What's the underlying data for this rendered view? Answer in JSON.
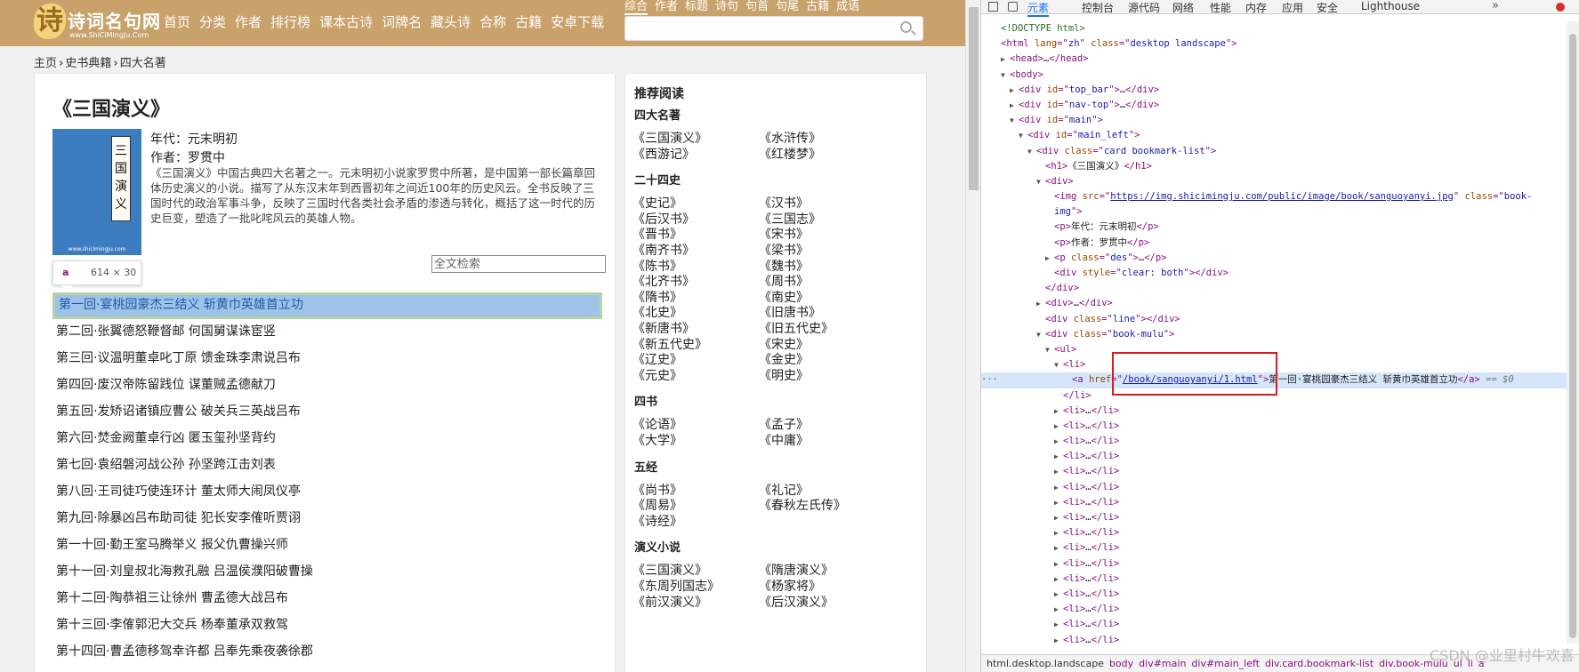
{
  "site": {
    "logo_text": "诗词名句网",
    "logo_url": "www.ShiCiMingJu.Com",
    "nav": [
      "首页",
      "分类",
      "作者",
      "排行榜",
      "课本古诗",
      "词牌名",
      "藏头诗",
      "合称",
      "古籍",
      "安卓下载"
    ],
    "search_tabs": [
      "综合",
      "作者",
      "标题",
      "诗句",
      "句首",
      "句尾",
      "古籍",
      "成语"
    ],
    "breadcrumb": [
      "主页",
      "史书典籍",
      "四大名著"
    ],
    "book": {
      "title": "《三国演义》",
      "cover_text": "三国演义",
      "cover_site": "www.shicimingju.com",
      "era": "年代：元末明初",
      "author": "作者：罗贯中",
      "description": "《三国演义》中国古典四大名著之一。元末明初小说家罗贯中所著，是中国第一部长篇章回体历史演义的小说。描写了从东汉末年到西晋初年之间近100年的历史风云。全书反映了三国时代的政治军事斗争，反映了三国时代各类社会矛盾的渗透与转化，概括了这一时代的历史巨变，塑造了一批叱咤风云的英雄人物。",
      "search_placeholder": "全文检索"
    },
    "tooltip": {
      "tag": "a",
      "size": "614 × 30"
    },
    "chapters": [
      "第一回·宴桃园豪杰三结义 斩黄巾英雄首立功",
      "第二回·张翼德怒鞭督邮 何国舅谋诛宦竖",
      "第三回·议温明董卓叱丁原 馈金珠李肃说吕布",
      "第四回·废汉帝陈留践位 谋董贼孟德献刀",
      "第五回·发矫诏诸镇应曹公 破关兵三英战吕布",
      "第六回·焚金阙董卓行凶 匿玉玺孙坚背约",
      "第七回·袁绍磐河战公孙 孙坚跨江击刘表",
      "第八回·王司徒巧使连环计 董太师大闹凤仪亭",
      "第九回·除暴凶吕布助司徒 犯长安李傕听贾诩",
      "第一十回·勤王室马腾举义 报父仇曹操兴师",
      "第十一回·刘皇叔北海救孔融 吕温侯濮阳破曹操",
      "第十二回·陶恭祖三让徐州 曹孟德大战吕布",
      "第十三回·李傕郭汜大交兵 杨奉董承双救驾",
      "第十四回·曹孟德移驾幸许都 吕奉先乘夜袭徐郡"
    ],
    "sidebar": {
      "title": "推荐阅读",
      "categories": [
        {
          "name": "四大名著",
          "books": [
            "《三国演义》",
            "《水浒传》",
            "《西游记》",
            "《红楼梦》"
          ]
        },
        {
          "name": "二十四史",
          "books": [
            "《史记》",
            "《汉书》",
            "《后汉书》",
            "《三国志》",
            "《晋书》",
            "《宋书》",
            "《南齐书》",
            "《梁书》",
            "《陈书》",
            "《魏书》",
            "《北齐书》",
            "《周书》",
            "《隋书》",
            "《南史》",
            "《北史》",
            "《旧唐书》",
            "《新唐书》",
            "《旧五代史》",
            "《新五代史》",
            "《宋史》",
            "《辽史》",
            "《金史》",
            "《元史》",
            "《明史》"
          ]
        },
        {
          "name": "四书",
          "books": [
            "《论语》",
            "《孟子》",
            "《大学》",
            "《中庸》"
          ]
        },
        {
          "name": "五经",
          "books": [
            "《尚书》",
            "《礼记》",
            "《周易》",
            "《春秋左氏传》",
            "《诗经》"
          ]
        },
        {
          "name": "演义小说",
          "books": [
            "《三国演义》",
            "《隋唐演义》",
            "《东周列国志》",
            "《杨家将》",
            "《前汉演义》",
            "《后汉演义》"
          ]
        }
      ]
    }
  },
  "devtools": {
    "tabs": [
      "元素",
      "控制台",
      "源代码",
      "网络",
      "性能",
      "内存",
      "应用",
      "安全",
      "Lighthouse"
    ],
    "tree": [
      {
        "i": 0,
        "t": "",
        "seg": [
          [
            "cm",
            "<!DOCTYPE html>"
          ]
        ]
      },
      {
        "i": 0,
        "t": "",
        "seg": [
          [
            "tg",
            "<html "
          ],
          [
            "at",
            "lang"
          ],
          [
            "tg",
            "=\""
          ],
          [
            "av",
            "zh"
          ],
          [
            "tg",
            "\" "
          ],
          [
            "at",
            "class"
          ],
          [
            "tg",
            "=\""
          ],
          [
            "av",
            "desktop landscape"
          ],
          [
            "tg",
            "\">"
          ]
        ]
      },
      {
        "i": 1,
        "t": "▶",
        "seg": [
          [
            "tg",
            "<head>"
          ],
          [
            "tx",
            "…"
          ],
          [
            "tg",
            "</head>"
          ]
        ]
      },
      {
        "i": 1,
        "t": "▼",
        "seg": [
          [
            "tg",
            "<body>"
          ]
        ]
      },
      {
        "i": 2,
        "t": "▶",
        "seg": [
          [
            "tg",
            "<div "
          ],
          [
            "at",
            "id"
          ],
          [
            "tg",
            "=\""
          ],
          [
            "av",
            "top_bar"
          ],
          [
            "tg",
            "\">"
          ],
          [
            "tx",
            "…"
          ],
          [
            "tg",
            "</div>"
          ]
        ]
      },
      {
        "i": 2,
        "t": "▶",
        "seg": [
          [
            "tg",
            "<div "
          ],
          [
            "at",
            "id"
          ],
          [
            "tg",
            "=\""
          ],
          [
            "av",
            "nav-top"
          ],
          [
            "tg",
            "\">"
          ],
          [
            "tx",
            "…"
          ],
          [
            "tg",
            "</div>"
          ]
        ]
      },
      {
        "i": 2,
        "t": "▼",
        "seg": [
          [
            "tg",
            "<div "
          ],
          [
            "at",
            "id"
          ],
          [
            "tg",
            "=\""
          ],
          [
            "av",
            "main"
          ],
          [
            "tg",
            "\">"
          ]
        ]
      },
      {
        "i": 3,
        "t": "▼",
        "seg": [
          [
            "tg",
            "<div "
          ],
          [
            "at",
            "id"
          ],
          [
            "tg",
            "=\""
          ],
          [
            "av",
            "main_left"
          ],
          [
            "tg",
            "\">"
          ]
        ]
      },
      {
        "i": 4,
        "t": "▼",
        "seg": [
          [
            "tg",
            "<div "
          ],
          [
            "at",
            "class"
          ],
          [
            "tg",
            "=\""
          ],
          [
            "av",
            "card bookmark-list"
          ],
          [
            "tg",
            "\">"
          ]
        ]
      },
      {
        "i": 5,
        "t": "",
        "seg": [
          [
            "tg",
            "<h1>"
          ],
          [
            "tx",
            "《三国演义》"
          ],
          [
            "tg",
            "</h1>"
          ]
        ]
      },
      {
        "i": 5,
        "t": "▼",
        "seg": [
          [
            "tg",
            "<div>"
          ]
        ]
      },
      {
        "i": 6,
        "t": "",
        "seg": [
          [
            "tg",
            "<img "
          ],
          [
            "at",
            "src"
          ],
          [
            "tg",
            "=\""
          ],
          [
            "lk",
            "https://img.shicimingju.com/public/image/book/sanguoyanyi.jpg"
          ],
          [
            "tg",
            "\" "
          ],
          [
            "at",
            "class"
          ],
          [
            "tg",
            "=\""
          ],
          [
            "av",
            "book-"
          ]
        ]
      },
      {
        "i": 6,
        "t": "",
        "seg": [
          [
            "av",
            "img"
          ],
          [
            "tg",
            "\">"
          ]
        ]
      },
      {
        "i": 6,
        "t": "",
        "seg": [
          [
            "tg",
            "<p>"
          ],
          [
            "tx",
            "年代：元末明初"
          ],
          [
            "tg",
            "</p>"
          ]
        ]
      },
      {
        "i": 6,
        "t": "",
        "seg": [
          [
            "tg",
            "<p>"
          ],
          [
            "tx",
            "作者：罗贯中"
          ],
          [
            "tg",
            "</p>"
          ]
        ]
      },
      {
        "i": 6,
        "t": "▶",
        "seg": [
          [
            "tg",
            "<p "
          ],
          [
            "at",
            "class"
          ],
          [
            "tg",
            "=\""
          ],
          [
            "av",
            "des"
          ],
          [
            "tg",
            "\">"
          ],
          [
            "tx",
            "…"
          ],
          [
            "tg",
            "</p>"
          ]
        ]
      },
      {
        "i": 6,
        "t": "",
        "seg": [
          [
            "tg",
            "<div "
          ],
          [
            "at",
            "style"
          ],
          [
            "tg",
            "=\""
          ],
          [
            "av",
            "clear: both"
          ],
          [
            "tg",
            "\"></div>"
          ]
        ]
      },
      {
        "i": 5,
        "t": "",
        "seg": [
          [
            "tg",
            "</div>"
          ]
        ]
      },
      {
        "i": 5,
        "t": "▶",
        "seg": [
          [
            "tg",
            "<div>"
          ],
          [
            "tx",
            "…"
          ],
          [
            "tg",
            "</div>"
          ]
        ]
      },
      {
        "i": 5,
        "t": "",
        "seg": [
          [
            "tg",
            "<div "
          ],
          [
            "at",
            "class"
          ],
          [
            "tg",
            "=\""
          ],
          [
            "av",
            "line"
          ],
          [
            "tg",
            "\"></div>"
          ]
        ]
      },
      {
        "i": 5,
        "t": "▼",
        "seg": [
          [
            "tg",
            "<div "
          ],
          [
            "at",
            "class"
          ],
          [
            "tg",
            "=\""
          ],
          [
            "av",
            "book-mulu"
          ],
          [
            "tg",
            "\">"
          ]
        ]
      },
      {
        "i": 6,
        "t": "▼",
        "seg": [
          [
            "tg",
            "<ul>"
          ]
        ]
      },
      {
        "i": 7,
        "t": "▼",
        "seg": [
          [
            "tg",
            "<li>"
          ]
        ]
      },
      {
        "i": 8,
        "t": "",
        "sel": true,
        "seg": [
          [
            "tg",
            "<a "
          ],
          [
            "at",
            "href"
          ],
          [
            "tg",
            "=\""
          ],
          [
            "lk",
            "/book/sanguoyanyi/1.html"
          ],
          [
            "tg",
            "\">"
          ],
          [
            "tx",
            "第一回·宴桃园豪杰三结义 斩黄巾英雄首立功"
          ],
          [
            "tg",
            "</a>"
          ],
          [
            "eq",
            " == $0"
          ]
        ]
      },
      {
        "i": 7,
        "t": "",
        "seg": [
          [
            "tg",
            "</li>"
          ]
        ]
      },
      {
        "i": 7,
        "t": "▶",
        "seg": [
          [
            "tg",
            "<li>"
          ],
          [
            "tx",
            "…"
          ],
          [
            "tg",
            "</li>"
          ]
        ]
      },
      {
        "i": 7,
        "t": "▶",
        "seg": [
          [
            "tg",
            "<li>"
          ],
          [
            "tx",
            "…"
          ],
          [
            "tg",
            "</li>"
          ]
        ]
      },
      {
        "i": 7,
        "t": "▶",
        "seg": [
          [
            "tg",
            "<li>"
          ],
          [
            "tx",
            "…"
          ],
          [
            "tg",
            "</li>"
          ]
        ]
      },
      {
        "i": 7,
        "t": "▶",
        "seg": [
          [
            "tg",
            "<li>"
          ],
          [
            "tx",
            "…"
          ],
          [
            "tg",
            "</li>"
          ]
        ]
      },
      {
        "i": 7,
        "t": "▶",
        "seg": [
          [
            "tg",
            "<li>"
          ],
          [
            "tx",
            "…"
          ],
          [
            "tg",
            "</li>"
          ]
        ]
      },
      {
        "i": 7,
        "t": "▶",
        "seg": [
          [
            "tg",
            "<li>"
          ],
          [
            "tx",
            "…"
          ],
          [
            "tg",
            "</li>"
          ]
        ]
      },
      {
        "i": 7,
        "t": "▶",
        "seg": [
          [
            "tg",
            "<li>"
          ],
          [
            "tx",
            "…"
          ],
          [
            "tg",
            "</li>"
          ]
        ]
      },
      {
        "i": 7,
        "t": "▶",
        "seg": [
          [
            "tg",
            "<li>"
          ],
          [
            "tx",
            "…"
          ],
          [
            "tg",
            "</li>"
          ]
        ]
      },
      {
        "i": 7,
        "t": "▶",
        "seg": [
          [
            "tg",
            "<li>"
          ],
          [
            "tx",
            "…"
          ],
          [
            "tg",
            "</li>"
          ]
        ]
      },
      {
        "i": 7,
        "t": "▶",
        "seg": [
          [
            "tg",
            "<li>"
          ],
          [
            "tx",
            "…"
          ],
          [
            "tg",
            "</li>"
          ]
        ]
      },
      {
        "i": 7,
        "t": "▶",
        "seg": [
          [
            "tg",
            "<li>"
          ],
          [
            "tx",
            "…"
          ],
          [
            "tg",
            "</li>"
          ]
        ]
      },
      {
        "i": 7,
        "t": "▶",
        "seg": [
          [
            "tg",
            "<li>"
          ],
          [
            "tx",
            "…"
          ],
          [
            "tg",
            "</li>"
          ]
        ]
      },
      {
        "i": 7,
        "t": "▶",
        "seg": [
          [
            "tg",
            "<li>"
          ],
          [
            "tx",
            "…"
          ],
          [
            "tg",
            "</li>"
          ]
        ]
      },
      {
        "i": 7,
        "t": "▶",
        "seg": [
          [
            "tg",
            "<li>"
          ],
          [
            "tx",
            "…"
          ],
          [
            "tg",
            "</li>"
          ]
        ]
      },
      {
        "i": 7,
        "t": "▶",
        "seg": [
          [
            "tg",
            "<li>"
          ],
          [
            "tx",
            "…"
          ],
          [
            "tg",
            "</li>"
          ]
        ]
      },
      {
        "i": 7,
        "t": "▶",
        "seg": [
          [
            "tg",
            "<li>"
          ],
          [
            "tx",
            "…"
          ],
          [
            "tg",
            "</li>"
          ]
        ]
      }
    ],
    "breadcrumbs": [
      "html.desktop.landscape",
      "body",
      "div#main",
      "div#main_left",
      "div.card.bookmark-list",
      "div.book-mulu",
      "ul",
      "li",
      "a"
    ]
  },
  "watermark": "CSDN @业里村牛欢喜",
  "colors": {
    "topbar": "#c9a16b",
    "highlight": "#9fc3e8",
    "annotation": "#e0191a",
    "devtools_accent": "#1a73e8"
  }
}
